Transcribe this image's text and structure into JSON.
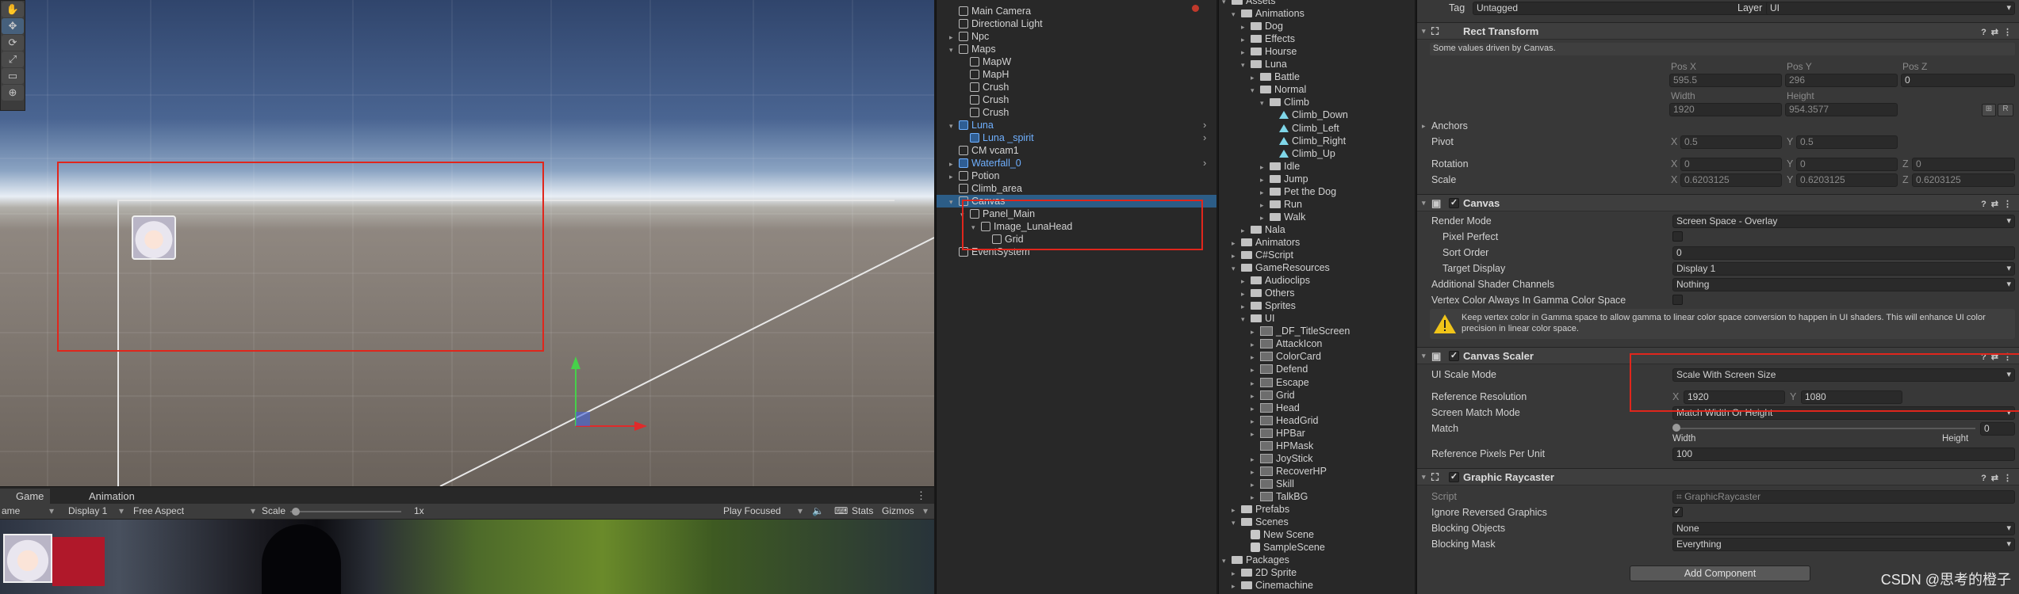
{
  "scene": {
    "tools": [
      "✋",
      "✥",
      "⟳",
      "⤢",
      "▭",
      "⊕"
    ],
    "axis_colors": {
      "y": "#46d14a",
      "x": "#e02a2a"
    }
  },
  "game": {
    "tabs": [
      "Game",
      "Animation"
    ],
    "toolbar": {
      "mode": "ame",
      "display": "Display 1",
      "aspect": "Free Aspect",
      "scale_label": "Scale",
      "scale_value": "1x",
      "play_mode": "Play Focused",
      "stats": "Stats",
      "gizmos": "Gizmos"
    }
  },
  "hierarchy": [
    {
      "label": "Main Camera",
      "depth": 1
    },
    {
      "label": "Directional Light",
      "depth": 1
    },
    {
      "label": "Npc",
      "depth": 1,
      "arrow": "▸"
    },
    {
      "label": "Maps",
      "depth": 1,
      "arrow": "▾"
    },
    {
      "label": "MapW",
      "depth": 2
    },
    {
      "label": "MapH",
      "depth": 2
    },
    {
      "label": "Crush",
      "depth": 2
    },
    {
      "label": "Crush",
      "depth": 2
    },
    {
      "label": "Crush",
      "depth": 2
    },
    {
      "label": "Luna",
      "depth": 1,
      "arrow": "▾",
      "blue": true
    },
    {
      "label": "Luna _spirit",
      "depth": 2,
      "blue": true
    },
    {
      "label": "CM vcam1",
      "depth": 1
    },
    {
      "label": "Waterfall_0",
      "depth": 1,
      "arrow": "▸",
      "blue": true
    },
    {
      "label": "Potion",
      "depth": 1,
      "arrow": "▸"
    },
    {
      "label": "Climb_area",
      "depth": 1
    },
    {
      "label": "Canvas",
      "depth": 1,
      "arrow": "▾"
    },
    {
      "label": "Panel_Main",
      "depth": 2,
      "arrow": "▾"
    },
    {
      "label": "Image_LunaHead",
      "depth": 3,
      "arrow": "▾"
    },
    {
      "label": "Grid",
      "depth": 4
    },
    {
      "label": "EventSystem",
      "depth": 1
    }
  ],
  "project": [
    {
      "label": "Assets",
      "depth": 0,
      "arrow": "▾",
      "type": "folder"
    },
    {
      "label": "Animations",
      "depth": 1,
      "arrow": "▾",
      "type": "folder"
    },
    {
      "label": "Dog",
      "depth": 2,
      "arrow": "▸",
      "type": "folder"
    },
    {
      "label": "Effects",
      "depth": 2,
      "arrow": "▸",
      "type": "folder"
    },
    {
      "label": "Hourse",
      "depth": 2,
      "arrow": "▸",
      "type": "folder"
    },
    {
      "label": "Luna",
      "depth": 2,
      "arrow": "▾",
      "type": "folder"
    },
    {
      "label": "Battle",
      "depth": 3,
      "arrow": "▸",
      "type": "folder"
    },
    {
      "label": "Normal",
      "depth": 3,
      "arrow": "▾",
      "type": "folder"
    },
    {
      "label": "Climb",
      "depth": 4,
      "arrow": "▾",
      "type": "folder"
    },
    {
      "label": "Climb_Down",
      "depth": 5,
      "type": "anim"
    },
    {
      "label": "Climb_Left",
      "depth": 5,
      "type": "anim"
    },
    {
      "label": "Climb_Right",
      "depth": 5,
      "type": "anim"
    },
    {
      "label": "Climb_Up",
      "depth": 5,
      "type": "anim"
    },
    {
      "label": "Idle",
      "depth": 4,
      "arrow": "▸",
      "type": "folder"
    },
    {
      "label": "Jump",
      "depth": 4,
      "arrow": "▸",
      "type": "folder"
    },
    {
      "label": "Pet the Dog",
      "depth": 4,
      "arrow": "▸",
      "type": "folder"
    },
    {
      "label": "Run",
      "depth": 4,
      "arrow": "▸",
      "type": "folder"
    },
    {
      "label": "Walk",
      "depth": 4,
      "arrow": "▸",
      "type": "folder"
    },
    {
      "label": "Nala",
      "depth": 2,
      "arrow": "▸",
      "type": "folder"
    },
    {
      "label": "Animators",
      "depth": 1,
      "arrow": "▸",
      "type": "folder"
    },
    {
      "label": "C#Script",
      "depth": 1,
      "arrow": "▸",
      "type": "folder"
    },
    {
      "label": "GameResources",
      "depth": 1,
      "arrow": "▾",
      "type": "folder"
    },
    {
      "label": "Audioclips",
      "depth": 2,
      "arrow": "▸",
      "type": "folder"
    },
    {
      "label": "Others",
      "depth": 2,
      "arrow": "▸",
      "type": "folder"
    },
    {
      "label": "Sprites",
      "depth": 2,
      "arrow": "▸",
      "type": "folder"
    },
    {
      "label": "UI",
      "depth": 2,
      "arrow": "▾",
      "type": "folder"
    },
    {
      "label": "_DF_TitleScreen",
      "depth": 3,
      "arrow": "▸",
      "type": "sprite"
    },
    {
      "label": "AttackIcon",
      "depth": 3,
      "arrow": "▸",
      "type": "sprite"
    },
    {
      "label": "ColorCard",
      "depth": 3,
      "arrow": "▸",
      "type": "sprite"
    },
    {
      "label": "Defend",
      "depth": 3,
      "arrow": "▸",
      "type": "sprite"
    },
    {
      "label": "Escape",
      "depth": 3,
      "arrow": "▸",
      "type": "sprite"
    },
    {
      "label": "Grid",
      "depth": 3,
      "arrow": "▸",
      "type": "sprite"
    },
    {
      "label": "Head",
      "depth": 3,
      "arrow": "▸",
      "type": "sprite"
    },
    {
      "label": "HeadGrid",
      "depth": 3,
      "arrow": "▸",
      "type": "sprite"
    },
    {
      "label": "HPBar",
      "depth": 3,
      "arrow": "▸",
      "type": "sprite"
    },
    {
      "label": "HPMask",
      "depth": 3,
      "type": "sprite"
    },
    {
      "label": "JoyStick",
      "depth": 3,
      "arrow": "▸",
      "type": "sprite"
    },
    {
      "label": "RecoverHP",
      "depth": 3,
      "arrow": "▸",
      "type": "sprite"
    },
    {
      "label": "Skill",
      "depth": 3,
      "arrow": "▸",
      "type": "sprite"
    },
    {
      "label": "TalkBG",
      "depth": 3,
      "arrow": "▸",
      "type": "sprite"
    },
    {
      "label": "Prefabs",
      "depth": 1,
      "arrow": "▸",
      "type": "folder"
    },
    {
      "label": "Scenes",
      "depth": 1,
      "arrow": "▾",
      "type": "folder"
    },
    {
      "label": "New Scene",
      "depth": 2,
      "type": "scene"
    },
    {
      "label": "SampleScene",
      "depth": 2,
      "type": "scene"
    },
    {
      "label": "Packages",
      "depth": 0,
      "arrow": "▾",
      "type": "folder"
    },
    {
      "label": "2D Sprite",
      "depth": 1,
      "arrow": "▸",
      "type": "folder"
    },
    {
      "label": "Cinemachine",
      "depth": 1,
      "arrow": "▸",
      "type": "folder"
    }
  ],
  "inspector": {
    "tag_label": "Tag",
    "tag_value": "Untagged",
    "layer_label": "Layer",
    "layer_value": "UI",
    "rect": {
      "title": "Rect Transform",
      "note": "Some values driven by Canvas.",
      "posx_label": "Pos X",
      "posy_label": "Pos Y",
      "posz_label": "Pos Z",
      "posx": "595.5",
      "posy": "296",
      "posz": "0",
      "width_label": "Width",
      "height_label": "Height",
      "width": "1920",
      "height": "954.3577",
      "anchors": "Anchors",
      "pivot": "Pivot",
      "pivot_x": "0.5",
      "pivot_y": "0.5",
      "rotation": "Rotation",
      "rot_x": "0",
      "rot_y": "0",
      "rot_z": "0",
      "scale": "Scale",
      "scale_x": "0.6203125",
      "scale_y": "0.6203125",
      "scale_z": "0.6203125",
      "x": "X",
      "y": "Y",
      "z": "Z",
      "r": "R"
    },
    "canvas": {
      "title": "Canvas",
      "render_mode": "Render Mode",
      "render_mode_value": "Screen Space - Overlay",
      "pixel_perfect": "Pixel Perfect",
      "sort_order": "Sort Order",
      "sort_order_value": "0",
      "target_display": "Target Display",
      "target_display_value": "Display 1",
      "shader_channels": "Additional Shader Channels",
      "shader_channels_value": "Nothing",
      "vertex_color": "Vertex Color Always In Gamma Color Space",
      "warning": "Keep vertex color in Gamma space to allow gamma to linear color space conversion to happen in UI shaders. This will enhance UI color precision in linear color space."
    },
    "scaler": {
      "title": "Canvas Scaler",
      "ui_scale_mode": "UI Scale Mode",
      "ui_scale_mode_value": "Scale With Screen Size",
      "ref_res": "Reference Resolution",
      "ref_x": "1920",
      "ref_y": "1080",
      "match_mode": "Screen Match Mode",
      "match_mode_value": "Match Width Or Height",
      "match": "Match",
      "match_value": "0",
      "match_width": "Width",
      "match_height": "Height",
      "ref_ppu": "Reference Pixels Per Unit",
      "ref_ppu_value": "100"
    },
    "raycaster": {
      "title": "Graphic Raycaster",
      "script": "Script",
      "script_value": "GraphicRaycaster",
      "ignore_reversed": "Ignore Reversed Graphics",
      "blocking_objects": "Blocking Objects",
      "blocking_objects_value": "None",
      "blocking_mask": "Blocking Mask",
      "blocking_mask_value": "Everything"
    },
    "add_component": "Add Component"
  },
  "watermark": "CSDN @思考的橙子"
}
